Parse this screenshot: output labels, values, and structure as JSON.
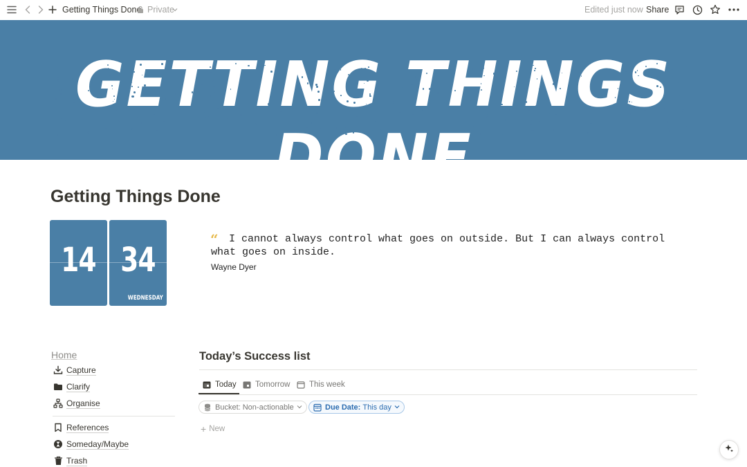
{
  "topbar": {
    "breadcrumb_title": "Getting Things Done",
    "privacy": "Private",
    "edited_status": "Edited just now",
    "share_label": "Share",
    "icons": [
      "menu-icon",
      "back-icon",
      "forward-icon",
      "add-icon",
      "lock-icon",
      "chevron-down-icon",
      "comment-icon",
      "history-icon",
      "star-icon",
      "more-icon"
    ]
  },
  "banner": {
    "text": "GETTING THINGS DONE",
    "color": "#4a7fa6"
  },
  "page": {
    "title": "Getting Things Done"
  },
  "clock": {
    "hours": "14",
    "minutes": "34",
    "day": "WEDNESDAY"
  },
  "quote": {
    "text": "I cannot always control what goes on outside. But I can always control what goes on inside.",
    "author": "Wayne Dyer",
    "accent": "#e6b94a"
  },
  "nav": {
    "home": "Home",
    "items": [
      {
        "label": "Capture",
        "icon": "download-icon"
      },
      {
        "label": "Clarify",
        "icon": "folder-icon"
      },
      {
        "label": "Organise",
        "icon": "sitemap-icon"
      },
      {
        "label": "References",
        "icon": "bookmark-icon"
      },
      {
        "label": "Someday/Maybe",
        "icon": "hourglass-icon"
      },
      {
        "label": "Trash",
        "icon": "trash-icon"
      }
    ]
  },
  "database": {
    "title": "Today’s Success list",
    "tabs": [
      {
        "label": "Today",
        "icon": "calendar-icon",
        "active": true
      },
      {
        "label": "Tomorrow",
        "icon": "calendar-icon",
        "active": false
      },
      {
        "label": "This week",
        "icon": "calendar-icon",
        "active": false
      }
    ],
    "filters": [
      {
        "label": "Bucket: Non-actionable",
        "icon": "database-icon"
      },
      {
        "label_key": "Due Date:",
        "label_value": "This day",
        "icon": "calendar-icon"
      }
    ],
    "new_label": "New"
  }
}
